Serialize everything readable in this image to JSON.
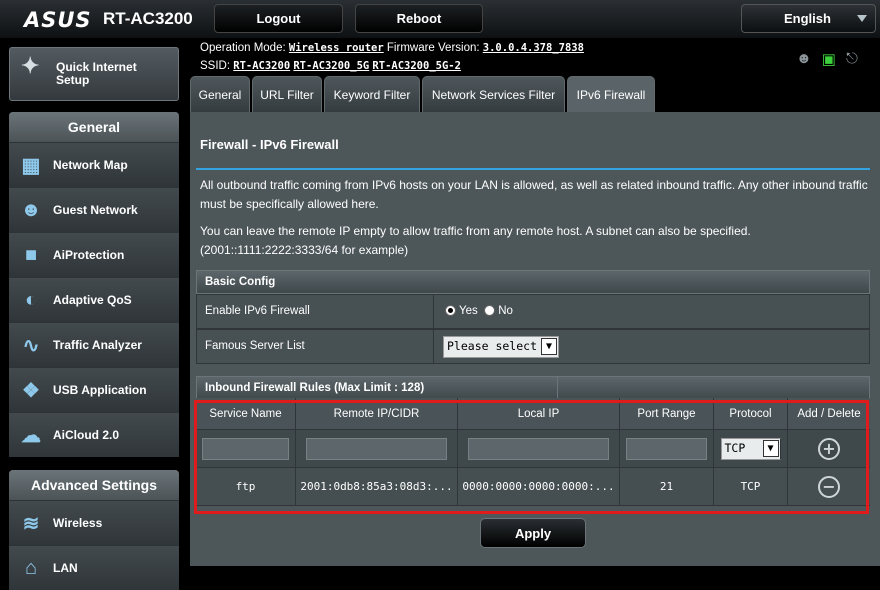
{
  "header": {
    "brand": "ASUS",
    "model": "RT-AC3200",
    "logout_label": "Logout",
    "reboot_label": "Reboot",
    "language": "English"
  },
  "info": {
    "operation_mode_label": "Operation Mode:",
    "operation_mode": "Wireless router",
    "firmware_label": "Firmware Version:",
    "firmware": "3.0.0.4.378_7838",
    "ssid_label": "SSID:",
    "ssids": [
      "RT-AC3200",
      "RT-AC3200_5G",
      "RT-AC3200_5G-2"
    ]
  },
  "sidebar": {
    "qis_label": "Quick Internet Setup",
    "general_heading": "General",
    "general_items": [
      {
        "label": "Network Map",
        "icon": "network-map-icon"
      },
      {
        "label": "Guest Network",
        "icon": "guest-network-icon"
      },
      {
        "label": "AiProtection",
        "icon": "lock-icon"
      },
      {
        "label": "Adaptive QoS",
        "icon": "gauge-icon"
      },
      {
        "label": "Traffic Analyzer",
        "icon": "chart-icon"
      },
      {
        "label": "USB Application",
        "icon": "puzzle-icon"
      },
      {
        "label": "AiCloud 2.0",
        "icon": "cloud-icon"
      }
    ],
    "advanced_heading": "Advanced Settings",
    "advanced_items": [
      {
        "label": "Wireless",
        "icon": "wifi-icon"
      },
      {
        "label": "LAN",
        "icon": "home-icon"
      }
    ]
  },
  "tabs": [
    "General",
    "URL Filter",
    "Keyword Filter",
    "Network Services Filter",
    "IPv6 Firewall"
  ],
  "active_tab": "IPv6 Firewall",
  "content": {
    "title": "Firewall - IPv6 Firewall",
    "para1": "All outbound traffic coming from IPv6 hosts on your LAN is allowed, as well as related inbound traffic. Any other inbound traffic must be specifically allowed here.",
    "para2": "You can leave the remote IP empty to allow traffic from any remote host. A subnet can also be specified. (2001::1111:2222:3333/64 for example)",
    "basic_config_heading": "Basic Config",
    "enable_label": "Enable IPv6 Firewall",
    "yes_label": "Yes",
    "no_label": "No",
    "enable_value": "Yes",
    "famous_label": "Famous Server List",
    "famous_value": "Please select",
    "rules_heading": "Inbound Firewall Rules (Max Limit : 128)",
    "columns": [
      "Service Name",
      "Remote IP/CIDR",
      "Local IP",
      "Port Range",
      "Protocol",
      "Add / Delete"
    ],
    "new_protocol": "TCP",
    "rows": [
      {
        "service": "ftp",
        "remote": "2001:0db8:85a3:08d3:...",
        "local": "0000:0000:0000:0000:...",
        "port": "21",
        "protocol": "TCP"
      }
    ],
    "apply_label": "Apply"
  },
  "colors": {
    "accent": "#35a3e0",
    "highlight": "#e01b1b",
    "status_green": "#3cd13c"
  }
}
